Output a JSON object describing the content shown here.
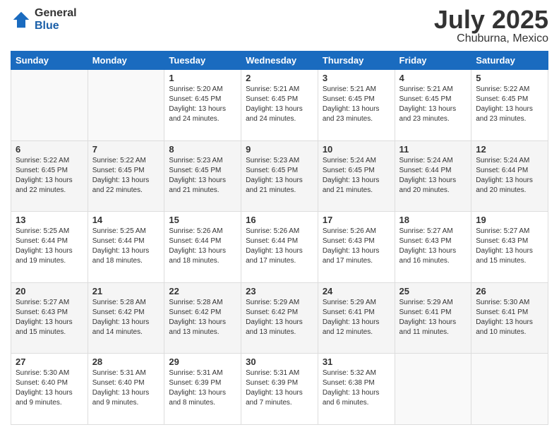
{
  "logo": {
    "general": "General",
    "blue": "Blue"
  },
  "title": {
    "month_year": "July 2025",
    "location": "Chuburna, Mexico"
  },
  "weekdays": [
    "Sunday",
    "Monday",
    "Tuesday",
    "Wednesday",
    "Thursday",
    "Friday",
    "Saturday"
  ],
  "weeks": [
    [
      {
        "day": "",
        "sunrise": "",
        "sunset": "",
        "daylight": ""
      },
      {
        "day": "",
        "sunrise": "",
        "sunset": "",
        "daylight": ""
      },
      {
        "day": "1",
        "sunrise": "Sunrise: 5:20 AM",
        "sunset": "Sunset: 6:45 PM",
        "daylight": "Daylight: 13 hours and 24 minutes."
      },
      {
        "day": "2",
        "sunrise": "Sunrise: 5:21 AM",
        "sunset": "Sunset: 6:45 PM",
        "daylight": "Daylight: 13 hours and 24 minutes."
      },
      {
        "day": "3",
        "sunrise": "Sunrise: 5:21 AM",
        "sunset": "Sunset: 6:45 PM",
        "daylight": "Daylight: 13 hours and 23 minutes."
      },
      {
        "day": "4",
        "sunrise": "Sunrise: 5:21 AM",
        "sunset": "Sunset: 6:45 PM",
        "daylight": "Daylight: 13 hours and 23 minutes."
      },
      {
        "day": "5",
        "sunrise": "Sunrise: 5:22 AM",
        "sunset": "Sunset: 6:45 PM",
        "daylight": "Daylight: 13 hours and 23 minutes."
      }
    ],
    [
      {
        "day": "6",
        "sunrise": "Sunrise: 5:22 AM",
        "sunset": "Sunset: 6:45 PM",
        "daylight": "Daylight: 13 hours and 22 minutes."
      },
      {
        "day": "7",
        "sunrise": "Sunrise: 5:22 AM",
        "sunset": "Sunset: 6:45 PM",
        "daylight": "Daylight: 13 hours and 22 minutes."
      },
      {
        "day": "8",
        "sunrise": "Sunrise: 5:23 AM",
        "sunset": "Sunset: 6:45 PM",
        "daylight": "Daylight: 13 hours and 21 minutes."
      },
      {
        "day": "9",
        "sunrise": "Sunrise: 5:23 AM",
        "sunset": "Sunset: 6:45 PM",
        "daylight": "Daylight: 13 hours and 21 minutes."
      },
      {
        "day": "10",
        "sunrise": "Sunrise: 5:24 AM",
        "sunset": "Sunset: 6:45 PM",
        "daylight": "Daylight: 13 hours and 21 minutes."
      },
      {
        "day": "11",
        "sunrise": "Sunrise: 5:24 AM",
        "sunset": "Sunset: 6:44 PM",
        "daylight": "Daylight: 13 hours and 20 minutes."
      },
      {
        "day": "12",
        "sunrise": "Sunrise: 5:24 AM",
        "sunset": "Sunset: 6:44 PM",
        "daylight": "Daylight: 13 hours and 20 minutes."
      }
    ],
    [
      {
        "day": "13",
        "sunrise": "Sunrise: 5:25 AM",
        "sunset": "Sunset: 6:44 PM",
        "daylight": "Daylight: 13 hours and 19 minutes."
      },
      {
        "day": "14",
        "sunrise": "Sunrise: 5:25 AM",
        "sunset": "Sunset: 6:44 PM",
        "daylight": "Daylight: 13 hours and 18 minutes."
      },
      {
        "day": "15",
        "sunrise": "Sunrise: 5:26 AM",
        "sunset": "Sunset: 6:44 PM",
        "daylight": "Daylight: 13 hours and 18 minutes."
      },
      {
        "day": "16",
        "sunrise": "Sunrise: 5:26 AM",
        "sunset": "Sunset: 6:44 PM",
        "daylight": "Daylight: 13 hours and 17 minutes."
      },
      {
        "day": "17",
        "sunrise": "Sunrise: 5:26 AM",
        "sunset": "Sunset: 6:43 PM",
        "daylight": "Daylight: 13 hours and 17 minutes."
      },
      {
        "day": "18",
        "sunrise": "Sunrise: 5:27 AM",
        "sunset": "Sunset: 6:43 PM",
        "daylight": "Daylight: 13 hours and 16 minutes."
      },
      {
        "day": "19",
        "sunrise": "Sunrise: 5:27 AM",
        "sunset": "Sunset: 6:43 PM",
        "daylight": "Daylight: 13 hours and 15 minutes."
      }
    ],
    [
      {
        "day": "20",
        "sunrise": "Sunrise: 5:27 AM",
        "sunset": "Sunset: 6:43 PM",
        "daylight": "Daylight: 13 hours and 15 minutes."
      },
      {
        "day": "21",
        "sunrise": "Sunrise: 5:28 AM",
        "sunset": "Sunset: 6:42 PM",
        "daylight": "Daylight: 13 hours and 14 minutes."
      },
      {
        "day": "22",
        "sunrise": "Sunrise: 5:28 AM",
        "sunset": "Sunset: 6:42 PM",
        "daylight": "Daylight: 13 hours and 13 minutes."
      },
      {
        "day": "23",
        "sunrise": "Sunrise: 5:29 AM",
        "sunset": "Sunset: 6:42 PM",
        "daylight": "Daylight: 13 hours and 13 minutes."
      },
      {
        "day": "24",
        "sunrise": "Sunrise: 5:29 AM",
        "sunset": "Sunset: 6:41 PM",
        "daylight": "Daylight: 13 hours and 12 minutes."
      },
      {
        "day": "25",
        "sunrise": "Sunrise: 5:29 AM",
        "sunset": "Sunset: 6:41 PM",
        "daylight": "Daylight: 13 hours and 11 minutes."
      },
      {
        "day": "26",
        "sunrise": "Sunrise: 5:30 AM",
        "sunset": "Sunset: 6:41 PM",
        "daylight": "Daylight: 13 hours and 10 minutes."
      }
    ],
    [
      {
        "day": "27",
        "sunrise": "Sunrise: 5:30 AM",
        "sunset": "Sunset: 6:40 PM",
        "daylight": "Daylight: 13 hours and 9 minutes."
      },
      {
        "day": "28",
        "sunrise": "Sunrise: 5:31 AM",
        "sunset": "Sunset: 6:40 PM",
        "daylight": "Daylight: 13 hours and 9 minutes."
      },
      {
        "day": "29",
        "sunrise": "Sunrise: 5:31 AM",
        "sunset": "Sunset: 6:39 PM",
        "daylight": "Daylight: 13 hours and 8 minutes."
      },
      {
        "day": "30",
        "sunrise": "Sunrise: 5:31 AM",
        "sunset": "Sunset: 6:39 PM",
        "daylight": "Daylight: 13 hours and 7 minutes."
      },
      {
        "day": "31",
        "sunrise": "Sunrise: 5:32 AM",
        "sunset": "Sunset: 6:38 PM",
        "daylight": "Daylight: 13 hours and 6 minutes."
      },
      {
        "day": "",
        "sunrise": "",
        "sunset": "",
        "daylight": ""
      },
      {
        "day": "",
        "sunrise": "",
        "sunset": "",
        "daylight": ""
      }
    ]
  ]
}
